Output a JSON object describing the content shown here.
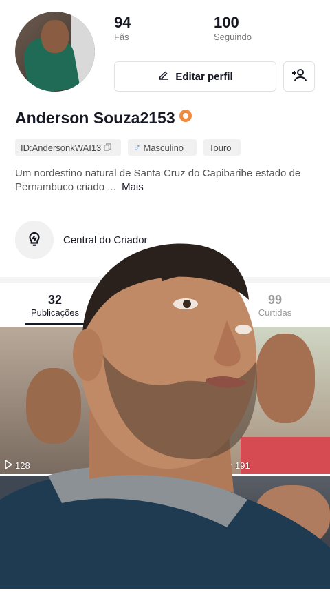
{
  "profile": {
    "followers_count": "94",
    "followers_label": "Fãs",
    "following_count": "100",
    "following_label": "Seguindo",
    "edit_label": "Editar perfil",
    "name": "Anderson Souza2153",
    "tags": {
      "id": "ID:AndersonkWAI13",
      "gender": "Masculino",
      "sign": "Touro"
    },
    "bio": "Um nordestino natural de Santa Cruz do Capibaribe estado de Pernambuco criado ...",
    "more_label": "Mais",
    "creator_center": "Central do Criador"
  },
  "tabs": [
    {
      "count": "32",
      "label": "Publicações"
    },
    {
      "count": "99",
      "label": "Curtidas"
    }
  ],
  "videos": [
    {
      "views": "128"
    },
    {
      "views": "191"
    }
  ],
  "colors": {
    "badge": "#f08a3c",
    "gender_icon": "#2b8fe6"
  }
}
